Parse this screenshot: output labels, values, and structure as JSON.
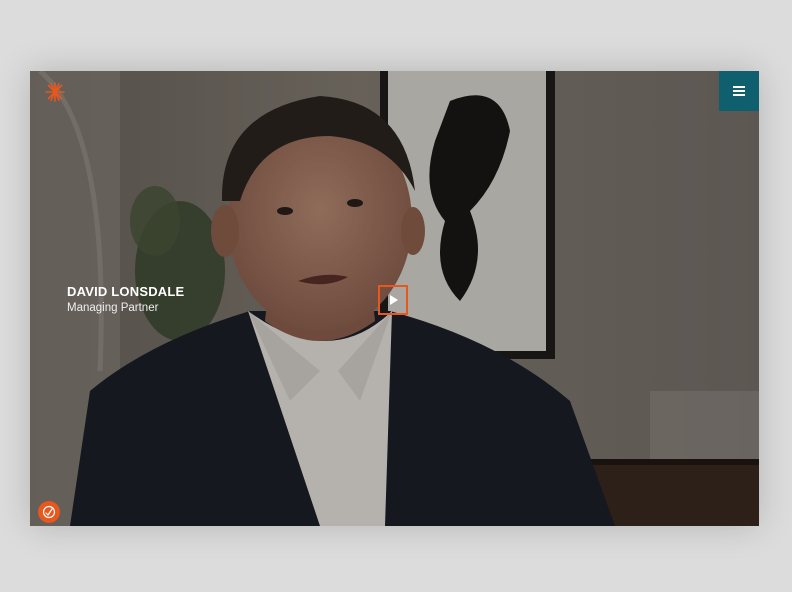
{
  "video": {
    "person_name": "DAVID LONSDALE",
    "person_title": "Managing Partner"
  },
  "icons": {
    "logo": "asterisk-logo-icon",
    "menu": "hamburger-menu-icon",
    "play": "play-icon",
    "badge": "circular-badge-icon"
  },
  "colors": {
    "accent": "#e8571e",
    "menu_bg": "#0f5f6e",
    "page_bg": "#dcdcdc"
  }
}
